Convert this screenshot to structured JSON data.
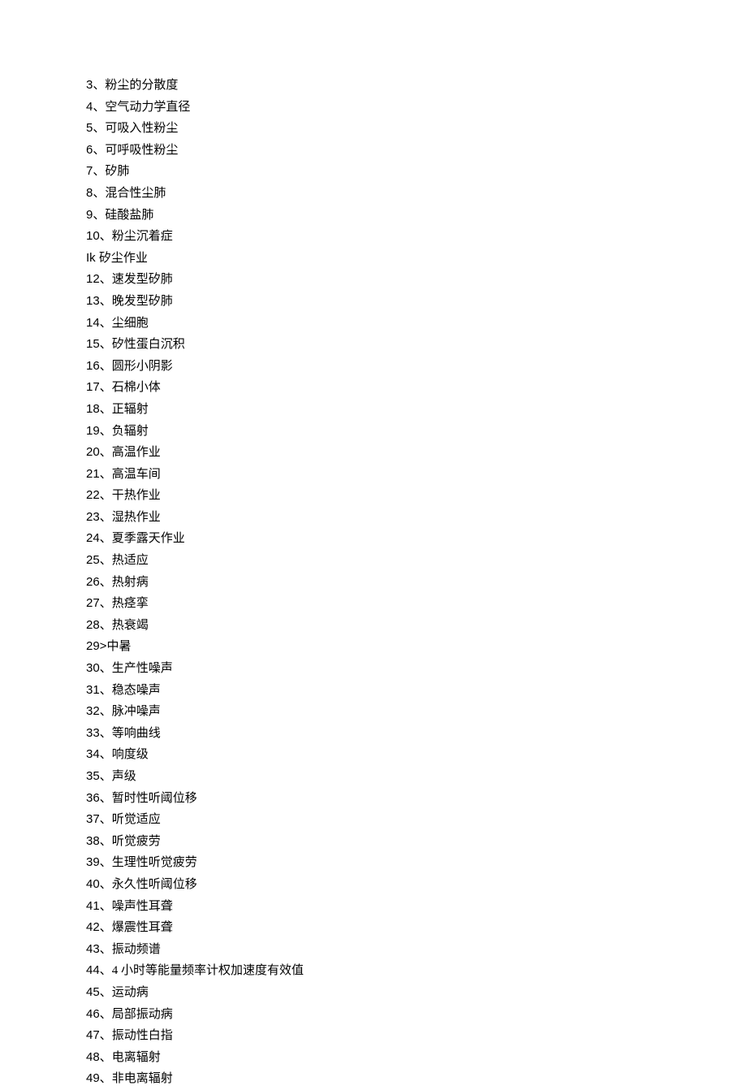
{
  "items": [
    {
      "num": "3、",
      "text": "粉尘的分散度"
    },
    {
      "num": "4、",
      "text": "空气动力学直径"
    },
    {
      "num": "5、",
      "text": "可吸入性粉尘"
    },
    {
      "num": "6、",
      "text": "可呼吸性粉尘"
    },
    {
      "num": "7、",
      "text": "矽肺"
    },
    {
      "num": "8、",
      "text": "混合性尘肺"
    },
    {
      "num": "9、",
      "text": "硅酸盐肺"
    },
    {
      "num": "10、",
      "text": "粉尘沉着症"
    },
    {
      "num": "Ik ",
      "text": "矽尘作业"
    },
    {
      "num": "12、",
      "text": "速发型矽肺"
    },
    {
      "num": "13、",
      "text": "晚发型矽肺"
    },
    {
      "num": "14、",
      "text": "尘细胞"
    },
    {
      "num": "15、",
      "text": "矽性蛋白沉积"
    },
    {
      "num": "16、",
      "text": "圆形小阴影"
    },
    {
      "num": "17、",
      "text": "石棉小体"
    },
    {
      "num": "18、",
      "text": "正辐射"
    },
    {
      "num": "19、",
      "text": "负辐射"
    },
    {
      "num": "20、",
      "text": "高温作业"
    },
    {
      "num": "21、",
      "text": "高温车间"
    },
    {
      "num": "22、",
      "text": "干热作业"
    },
    {
      "num": "23、",
      "text": "湿热作业"
    },
    {
      "num": "24、",
      "text": "夏季露天作业"
    },
    {
      "num": "25、",
      "text": "热适应"
    },
    {
      "num": "26、",
      "text": "热射病"
    },
    {
      "num": "27、",
      "text": "热痉挛"
    },
    {
      "num": "28、",
      "text": "热衰竭"
    },
    {
      "num": "29>",
      "text": "中暑"
    },
    {
      "num": "30、",
      "text": "生产性噪声"
    },
    {
      "num": "31、",
      "text": "稳态噪声"
    },
    {
      "num": "32、",
      "text": "脉冲噪声"
    },
    {
      "num": "33、",
      "text": "等响曲线"
    },
    {
      "num": "34、",
      "text": "响度级"
    },
    {
      "num": "35、",
      "text": "声级"
    },
    {
      "num": "36、",
      "text": "暂时性听阈位移"
    },
    {
      "num": "37、",
      "text": "听觉适应"
    },
    {
      "num": "38、",
      "text": "听觉疲劳"
    },
    {
      "num": "39、",
      "text": "生理性听觉疲劳"
    },
    {
      "num": "40、",
      "text": "永久性听阈位移"
    },
    {
      "num": "41、",
      "text": "噪声性耳聋"
    },
    {
      "num": "42、",
      "text": "爆震性耳聋"
    },
    {
      "num": "43、",
      "text": "振动频谱"
    },
    {
      "num": "44、",
      "text": "4 小时等能量频率计权加速度有效值"
    },
    {
      "num": "45、",
      "text": "运动病"
    },
    {
      "num": "46、",
      "text": "局部振动病"
    },
    {
      "num": "47、",
      "text": "振动性白指"
    },
    {
      "num": "48、",
      "text": "电离辐射"
    },
    {
      "num": "49、",
      "text": "非电离辐射"
    }
  ]
}
